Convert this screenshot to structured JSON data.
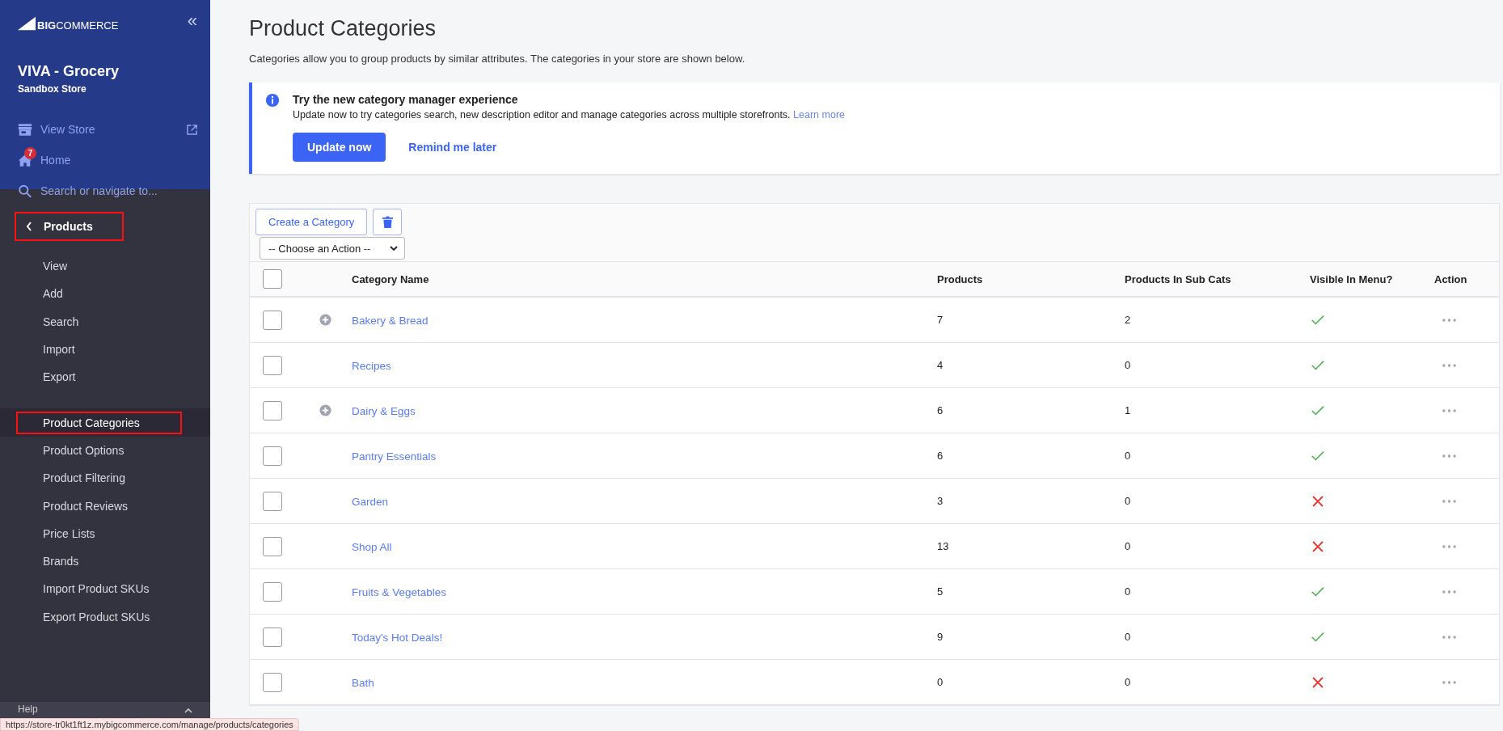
{
  "sidebar": {
    "logo": {
      "big": "BIG",
      "rest": "COMMERCE"
    },
    "collapse": "«",
    "store_name": "VIVA - Grocery",
    "store_type": "Sandbox Store",
    "links": [
      {
        "kind": "store",
        "label": "View Store"
      },
      {
        "kind": "home",
        "label": "Home",
        "badge": "7"
      },
      {
        "kind": "search",
        "label": "Search or navigate to..."
      }
    ],
    "section": {
      "label": "Products",
      "highlighted": true
    },
    "item_groups": [
      {
        "items": [
          {
            "label": "View",
            "selected": false,
            "highlighted": false
          },
          {
            "label": "Add",
            "selected": false,
            "highlighted": false
          },
          {
            "label": "Search",
            "selected": false,
            "highlighted": false
          },
          {
            "label": "Import",
            "selected": false,
            "highlighted": false
          },
          {
            "label": "Export",
            "selected": false,
            "highlighted": false
          }
        ]
      },
      {
        "items": [
          {
            "label": "Product Categories",
            "selected": true,
            "highlighted": true
          },
          {
            "label": "Product Options",
            "selected": false,
            "highlighted": false
          },
          {
            "label": "Product Filtering",
            "selected": false,
            "highlighted": false
          },
          {
            "label": "Product Reviews",
            "selected": false,
            "highlighted": false
          },
          {
            "label": "Price Lists",
            "selected": false,
            "highlighted": false
          },
          {
            "label": "Brands",
            "selected": false,
            "highlighted": false
          },
          {
            "label": "Import Product SKUs",
            "selected": false,
            "highlighted": false
          },
          {
            "label": "Export Product SKUs",
            "selected": false,
            "highlighted": false
          }
        ]
      }
    ],
    "footer": "Help"
  },
  "page": {
    "title": "Product Categories",
    "description": "Categories allow you to group products by similar attributes. The categories in your store are shown below."
  },
  "banner": {
    "title": "Try the new category manager experience",
    "text": "Update now to try categories search, new description editor and manage categories across multiple storefronts.",
    "link": "Learn more",
    "primary": "Update now",
    "secondary": "Remind me later"
  },
  "toolbar": {
    "create": "Create a Category",
    "action_select": "-- Choose an Action --"
  },
  "table": {
    "select_all_checked": false,
    "columns": [
      "Category Name",
      "Products",
      "Products In Sub Cats",
      "Visible In Menu?",
      "Action"
    ],
    "rows": [
      {
        "name": "Bakery & Bread",
        "products": "7",
        "sub": "2",
        "visible": true,
        "expandable": true,
        "checked": false
      },
      {
        "name": "Recipes",
        "products": "4",
        "sub": "0",
        "visible": true,
        "expandable": false,
        "checked": false
      },
      {
        "name": "Dairy & Eggs",
        "products": "6",
        "sub": "1",
        "visible": true,
        "expandable": true,
        "checked": false
      },
      {
        "name": "Pantry Essentials",
        "products": "6",
        "sub": "0",
        "visible": true,
        "expandable": false,
        "checked": false
      },
      {
        "name": "Garden",
        "products": "3",
        "sub": "0",
        "visible": false,
        "expandable": false,
        "checked": false
      },
      {
        "name": "Shop All",
        "products": "13",
        "sub": "0",
        "visible": false,
        "expandable": false,
        "checked": false
      },
      {
        "name": "Fruits & Vegetables",
        "products": "5",
        "sub": "0",
        "visible": true,
        "expandable": false,
        "checked": false
      },
      {
        "name": "Today's Hot Deals!",
        "products": "9",
        "sub": "0",
        "visible": true,
        "expandable": false,
        "checked": false
      },
      {
        "name": "Bath",
        "products": "0",
        "sub": "0",
        "visible": false,
        "expandable": false,
        "checked": false
      }
    ]
  },
  "status_bar": {
    "url": "https://store-tr0kt1ft1z.mybigcommerce.com/manage/products/categories"
  }
}
